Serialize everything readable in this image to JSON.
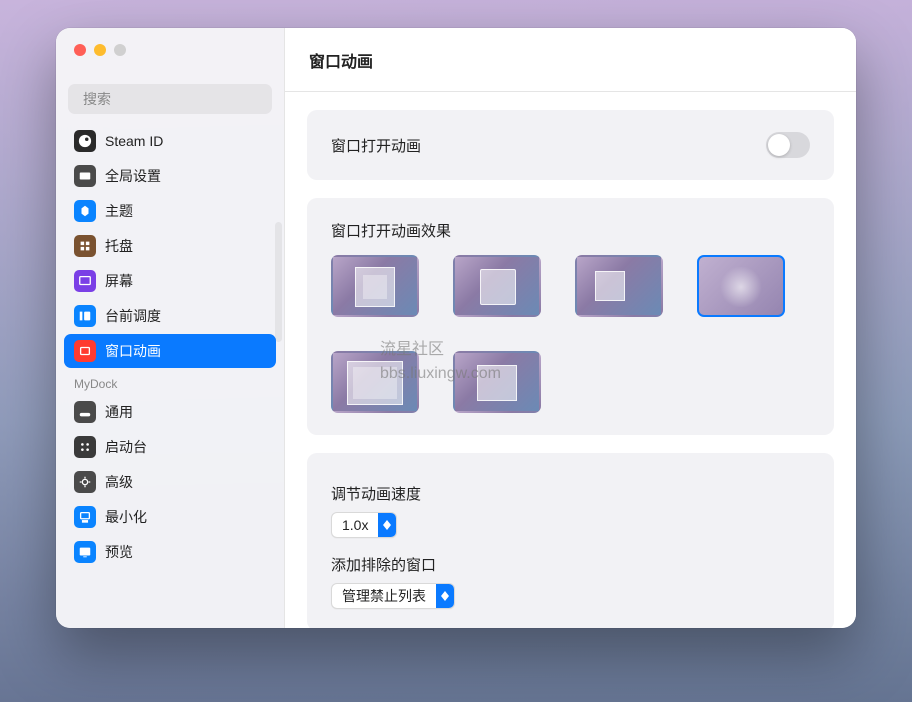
{
  "watermark": {
    "line1": "流星社区",
    "line2": "bbs.liuxingw.com"
  },
  "traffic": {
    "close": "close",
    "min": "minimize",
    "max": "maximize"
  },
  "search": {
    "placeholder": "搜索"
  },
  "sidebar": {
    "items": [
      {
        "label": "Steam ID",
        "icon": "steam-icon"
      },
      {
        "label": "全局设置",
        "icon": "settings-icon"
      },
      {
        "label": "主题",
        "icon": "theme-icon"
      },
      {
        "label": "托盘",
        "icon": "tray-icon"
      },
      {
        "label": "屏幕",
        "icon": "screen-icon"
      },
      {
        "label": "台前调度",
        "icon": "stage-icon"
      },
      {
        "label": "窗口动画",
        "icon": "window-anim-icon",
        "active": true
      }
    ],
    "section_header": "MyDock",
    "dock_items": [
      {
        "label": "通用",
        "icon": "general-icon"
      },
      {
        "label": "启动台",
        "icon": "launchpad-icon"
      },
      {
        "label": "高级",
        "icon": "advanced-icon"
      },
      {
        "label": "最小化",
        "icon": "minimize-icon"
      },
      {
        "label": "预览",
        "icon": "preview-icon"
      }
    ]
  },
  "main": {
    "title": "窗口动画",
    "open_anim": {
      "label": "窗口打开动画",
      "enabled": false
    },
    "effect_section": {
      "label": "窗口打开动画效果",
      "selected_index": 3
    },
    "speed": {
      "label": "调节动画速度",
      "value": "1.0x"
    },
    "exclude": {
      "label": "添加排除的窗口",
      "value": "管理禁止列表"
    }
  }
}
